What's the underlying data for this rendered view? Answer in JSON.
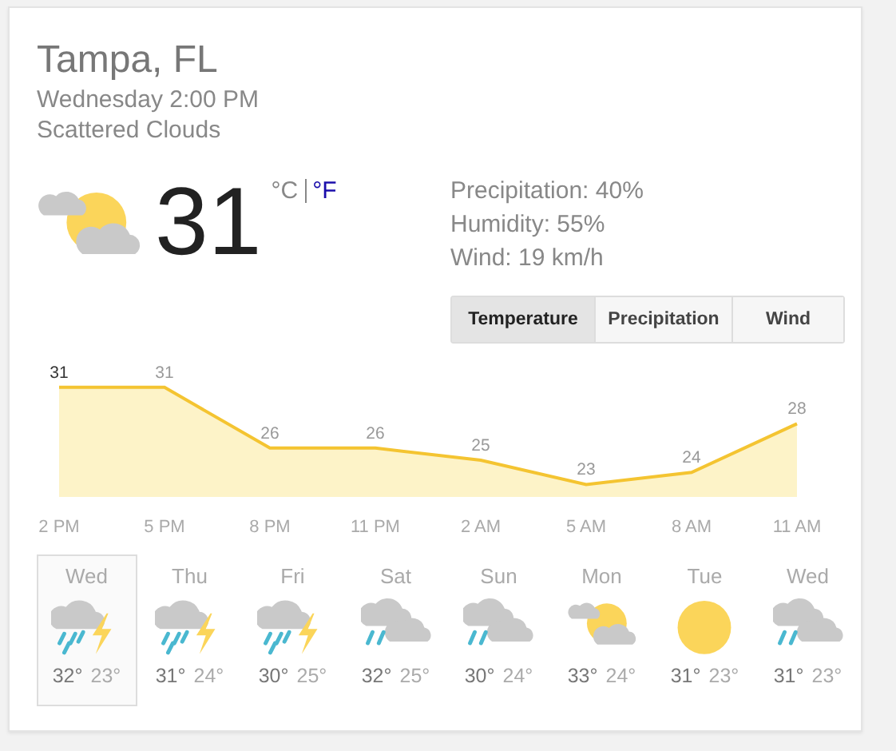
{
  "location": "Tampa, FL",
  "datetime": "Wednesday 2:00 PM",
  "condition": "Scattered Clouds",
  "current": {
    "kind": "partly-cloudy",
    "temperature": "31",
    "units": [
      {
        "label": "°C",
        "selected": true
      },
      {
        "label": "°F",
        "selected": false
      }
    ]
  },
  "details": [
    "Precipitation: 40%",
    "Humidity: 55%",
    "Wind: 19 km/h"
  ],
  "tabs": [
    {
      "label": "Temperature",
      "selected": true
    },
    {
      "label": "Precipitation",
      "selected": false
    },
    {
      "label": "Wind",
      "selected": false
    }
  ],
  "chart": {
    "chart_data": {
      "type": "area",
      "categories": [
        "2 PM",
        "5 PM",
        "8 PM",
        "11 PM",
        "2 AM",
        "5 AM",
        "8 AM",
        "11 AM"
      ],
      "values": [
        31,
        31,
        26,
        26,
        25,
        23,
        24,
        28
      ],
      "data_labels": true
    }
  },
  "days": [
    {
      "day": "Wed",
      "kind": "storm",
      "high": "32°",
      "low": "23°",
      "selected": true
    },
    {
      "day": "Thu",
      "kind": "storm",
      "high": "31°",
      "low": "24°",
      "selected": false
    },
    {
      "day": "Fri",
      "kind": "storm",
      "high": "30°",
      "low": "25°",
      "selected": false
    },
    {
      "day": "Sat",
      "kind": "rain",
      "high": "32°",
      "low": "25°",
      "selected": false
    },
    {
      "day": "Sun",
      "kind": "rain",
      "high": "30°",
      "low": "24°",
      "selected": false
    },
    {
      "day": "Mon",
      "kind": "partly-cloudy",
      "high": "33°",
      "low": "24°",
      "selected": false
    },
    {
      "day": "Tue",
      "kind": "sunny",
      "high": "31°",
      "low": "23°",
      "selected": false
    },
    {
      "day": "Wed",
      "kind": "rain",
      "high": "31°",
      "low": "23°",
      "selected": false
    }
  ]
}
